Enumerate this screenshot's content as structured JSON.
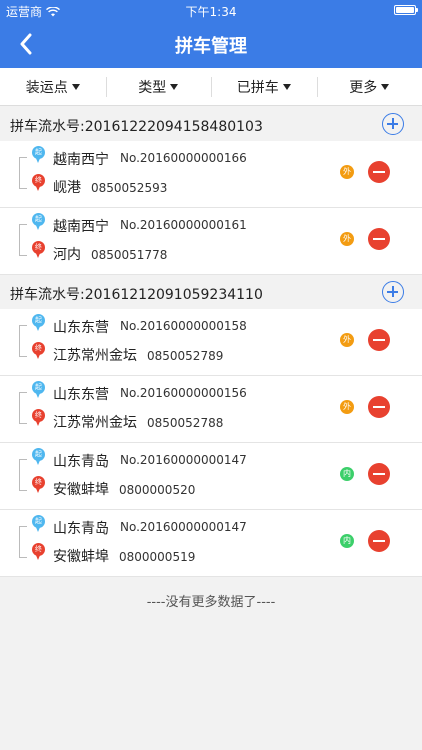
{
  "status_bar": {
    "carrier": "运营商",
    "time": "下午1:34"
  },
  "nav": {
    "title": "拼车管理"
  },
  "filters": [
    {
      "label": "装运点"
    },
    {
      "label": "类型"
    },
    {
      "label": "已拼车"
    },
    {
      "label": "更多"
    }
  ],
  "icons": {
    "start_pin": "起",
    "end_pin": "终"
  },
  "groups": [
    {
      "serial": "拼车流水号:20161222094158480103",
      "items": [
        {
          "origin": "越南西宁",
          "order": "No.20160000000166",
          "destination": "岘港",
          "code": "0850052593",
          "tag": "外",
          "tag_color": "#f39c12"
        },
        {
          "origin": "越南西宁",
          "order": "No.20160000000161",
          "destination": "河内",
          "code": "0850051778",
          "tag": "外",
          "tag_color": "#f39c12"
        }
      ]
    },
    {
      "serial": "拼车流水号:20161212091059234110",
      "items": [
        {
          "origin": "山东东营",
          "order": "No.20160000000158",
          "destination": "江苏常州金坛",
          "code": "0850052789",
          "tag": "外",
          "tag_color": "#f39c12"
        },
        {
          "origin": "山东东营",
          "order": "No.20160000000156",
          "destination": "江苏常州金坛",
          "code": "0850052788",
          "tag": "外",
          "tag_color": "#f39c12"
        },
        {
          "origin": "山东青岛",
          "order": "No.20160000000147",
          "destination": "安徽蚌埠",
          "code": "0800000520",
          "tag": "内",
          "tag_color": "#3ccf6a"
        },
        {
          "origin": "山东青岛",
          "order": "No.20160000000147",
          "destination": "安徽蚌埠",
          "code": "0800000519",
          "tag": "内",
          "tag_color": "#3ccf6a"
        }
      ]
    }
  ],
  "footer": {
    "no_more": "----没有更多数据了----"
  },
  "colors": {
    "primary": "#3b7ce6",
    "danger": "#e8412f",
    "start_pin": "#4fb7ef"
  }
}
